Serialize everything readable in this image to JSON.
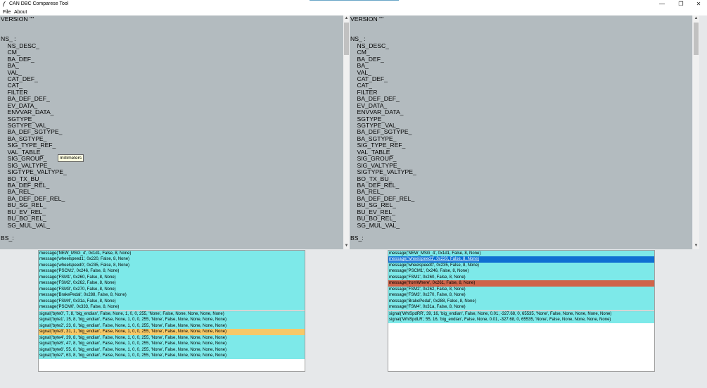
{
  "window": {
    "title": "CAN DBC Comparese Tool",
    "controls": [
      "—",
      "❐",
      "✕"
    ]
  },
  "menu": [
    "File",
    "About"
  ],
  "left_text": "VERSION \"\"\n\n\nNS_ :\n    NS_DESC_\n    CM_\n    BA_DEF_\n    BA_\n    VAL_\n    CAT_DEF_\n    CAT_\n    FILTER\n    BA_DEF_DEF_\n    EV_DATA_\n    ENVVAR_DATA_\n    SGTYPE_\n    SGTYPE_VAL_\n    BA_DEF_SGTYPE_\n    BA_SGTYPE_\n    SIG_TYPE_REF_\n    VAL_TABLE_\n    SIG_GROUP_\n    SIG_VALTYPE_\n    SIGTYPE_VALTYPE_\n    BO_TX_BU_\n    BA_DEF_REL_\n    BA_REL_\n    BA_DEF_DEF_REL_\n    BU_SG_REL_\n    BU_EV_REL_\n    BU_BO_REL_\n    SG_MUL_VAL_\n\nBS_:",
  "right_text": "VERSION \"\"\n\n\nNS_ :\n    NS_DESC_\n    CM_\n    BA_DEF_\n    BA_\n    VAL_\n    CAT_DEF_\n    CAT_\n    FILTER\n    BA_DEF_DEF_\n    EV_DATA_\n    ENVVAR_DATA_\n    SGTYPE_\n    SGTYPE_VAL_\n    BA_DEF_SGTYPE_\n    BA_SGTYPE_\n    SIG_TYPE_REF_\n    VAL_TABLE_\n    SIG_GROUP_\n    SIG_VALTYPE_\n    SIGTYPE_VALTYPE_\n    BO_TX_BU_\n    BA_DEF_REL_\n    BA_REL_\n    BA_DEF_DEF_REL_\n    BU_SG_REL_\n    BU_EV_REL_\n    BU_BO_REL_\n    SG_MUL_VAL_\n\nBS_:",
  "tooltip": "millimeters",
  "left_messages": [
    {
      "text": "message('NEW_MSG_4', 0x1d1, False, 8, None)",
      "state": "normal"
    },
    {
      "text": "message('wheelspeed1', 0x220, False, 8, None)",
      "state": "normal"
    },
    {
      "text": "message('wheelspeed0', 0x235, False, 8, None)",
      "state": "normal"
    },
    {
      "text": "message('PSCM1', 0x246, False, 8, None)",
      "state": "normal"
    },
    {
      "text": "message('FSM1', 0x260, False, 8, None)",
      "state": "normal"
    },
    {
      "text": "message('FSM2', 0x262, False, 8, None)",
      "state": "normal"
    },
    {
      "text": "message('FSM3', 0x270, False, 8, None)",
      "state": "normal"
    },
    {
      "text": "message('BrakePedal', 0x288, False, 8, None)",
      "state": "normal"
    },
    {
      "text": "message('FSM4', 0x31a, False, 8, None)",
      "state": "normal"
    },
    {
      "text": "message('PSCM0', 0x333, False, 8, None)",
      "state": "normal"
    }
  ],
  "left_signals": [
    {
      "text": "signal('byte0', 7, 8, 'big_endian', False, None, 1, 0, 0, 255, 'None', False, None, None, None, None)",
      "state": "normal"
    },
    {
      "text": "signal('byte1', 15, 8, 'big_endian', False, None, 1, 0, 0, 255, 'None', False, None, None, None, None)",
      "state": "normal"
    },
    {
      "text": "signal('byte2', 23, 8, 'big_endian', False, None, 1, 0, 0, 255, 'None', False, None, None, None, None)",
      "state": "normal"
    },
    {
      "text": "signal('byte3', 31, 1, 'big_endian', False, None, 1, 0, 0, 255, 'None', False, None, None, None, None)",
      "state": "orange"
    },
    {
      "text": "signal('byte4', 39, 8, 'big_endian', False, None, 1, 0, 0, 255, 'None', False, None, None, None, None)",
      "state": "normal"
    },
    {
      "text": "signal('byte5', 47, 8, 'big_endian', False, None, 1, 0, 0, 255, 'None', False, None, None, None, None)",
      "state": "normal"
    },
    {
      "text": "signal('byte6', 55, 8, 'big_endian', False, None, 1, 0, 0, 255, 'None', False, None, None, None, None)",
      "state": "normal"
    },
    {
      "text": "signal('byte7', 63, 8, 'big_endian', False, None, 1, 0, 0, 255, 'None', False, None, None, None, None)",
      "state": "normal"
    }
  ],
  "right_messages": [
    {
      "text": "message('NEW_MSG_4', 0x1d1, False, 8, None)",
      "state": "normal"
    },
    {
      "text": "message('wheelspeed1', 0x220, False, 8, None)",
      "state": "blue"
    },
    {
      "text": "message('wheelspeed0', 0x235, False, 8, None)",
      "state": "normal"
    },
    {
      "text": "message('PSCM1', 0x246, False, 8, None)",
      "state": "normal"
    },
    {
      "text": "message('FSM1', 0x260, False, 8, None)",
      "state": "normal"
    },
    {
      "text": "message('fromWhere', 0x261, False, 8, None)",
      "state": "red"
    },
    {
      "text": "message('FSM2', 0x262, False, 8, None)",
      "state": "normal"
    },
    {
      "text": "message('FSM3', 0x270, False, 8, None)",
      "state": "normal"
    },
    {
      "text": "message('BrakePedal', 0x288, False, 8, None)",
      "state": "normal"
    },
    {
      "text": "message('FSM4', 0x31a, False, 8, None)",
      "state": "normal"
    }
  ],
  "right_signals": [
    {
      "text": "signal('WhlSpdRR', 39, 16, 'big_endian', False, None, 0.01, -327.68, 0, 65535, 'None', False, None, None, None, None)",
      "state": "normal"
    },
    {
      "text": "signal('WhlSpdLR', 55, 16, 'big_endian', False, None, 0.01, -327.68, 0, 65535, 'None', False, None, None, None, None)",
      "state": "normal"
    }
  ],
  "colors": {
    "text_area": "#b3bbbf",
    "list_row": "#7de9e9",
    "selected_blue": "#0f6fd2",
    "diff_red": "#d0644a",
    "diff_orange": "#f6c868",
    "background": "#e6e8ea"
  },
  "icons": {
    "app": "feather-icon",
    "scroll_up": "scroll-up-arrow-icon",
    "scroll_down": "scroll-down-arrow-icon"
  }
}
